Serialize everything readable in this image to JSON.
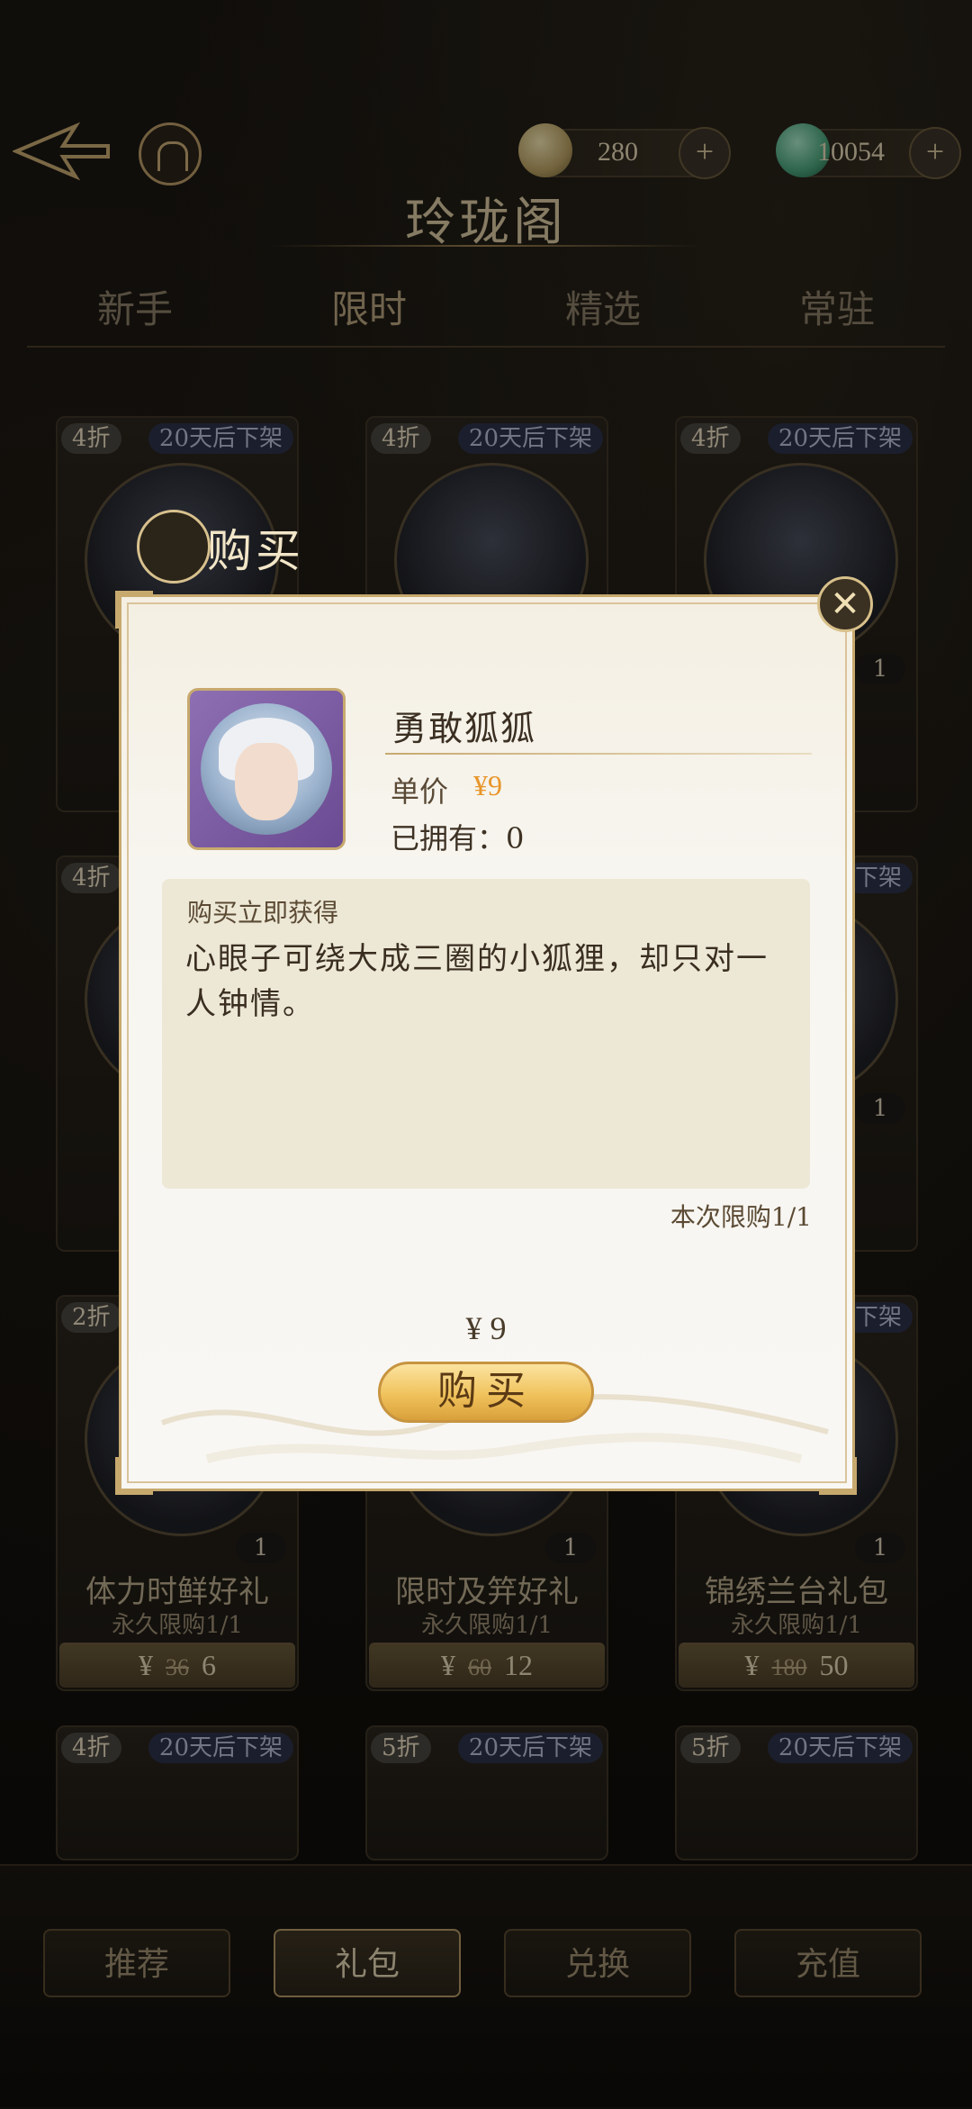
{
  "header": {
    "title": "玲珑阁",
    "currencies": [
      {
        "icon": "coin-icon",
        "value": "280"
      },
      {
        "icon": "jade-icon",
        "value": "10054"
      }
    ]
  },
  "tabs": [
    {
      "label": "新手",
      "active": false
    },
    {
      "label": "限时",
      "active": true
    },
    {
      "label": "精选",
      "active": false
    },
    {
      "label": "常驻",
      "active": false
    }
  ],
  "cards": [
    {
      "badge": "4折",
      "off": "20天后下架",
      "count": "",
      "name": "",
      "limit": "",
      "orig": "",
      "price": ""
    },
    {
      "badge": "4折",
      "off": "20天后下架",
      "count": "",
      "name": "",
      "limit": "",
      "orig": "",
      "price": ""
    },
    {
      "badge": "4折",
      "off": "20天后下架",
      "count": "1",
      "name": "",
      "limit": "",
      "orig": "",
      "price": ""
    },
    {
      "badge": "4折",
      "off": "",
      "count": "",
      "name": "",
      "limit": "",
      "orig": "",
      "price": ""
    },
    {
      "badge": "",
      "off": "",
      "count": "",
      "name": "",
      "limit": "",
      "orig": "",
      "price": ""
    },
    {
      "badge": "",
      "off": "下架",
      "count": "1",
      "name": "",
      "limit": "",
      "orig": "",
      "price": ""
    },
    {
      "badge": "2折",
      "off": "",
      "count": "1",
      "name": "体力时鲜好礼",
      "limit": "永久限购1/1",
      "orig": "36",
      "price": "6"
    },
    {
      "badge": "",
      "off": "",
      "count": "1",
      "name": "限时及笄好礼",
      "limit": "永久限购1/1",
      "orig": "60",
      "price": "12"
    },
    {
      "badge": "",
      "off": "下架",
      "count": "1",
      "name": "锦绣兰台礼包",
      "limit": "永久限购1/1",
      "orig": "180",
      "price": "50"
    },
    {
      "badge": "4折",
      "off": "20天后下架",
      "count": "",
      "name": "",
      "limit": "",
      "orig": "",
      "price": ""
    },
    {
      "badge": "5折",
      "off": "20天后下架",
      "count": "",
      "name": "",
      "limit": "",
      "orig": "",
      "price": ""
    },
    {
      "badge": "5折",
      "off": "20天后下架",
      "count": "",
      "name": "",
      "limit": "",
      "orig": "",
      "price": ""
    }
  ],
  "currency_symbol": "¥",
  "bottom_nav": [
    {
      "label": "推荐",
      "active": false
    },
    {
      "label": "礼包",
      "active": true
    },
    {
      "label": "兑换",
      "active": false
    },
    {
      "label": "充值",
      "active": false
    }
  ],
  "modal": {
    "title": "购买",
    "item_name": "勇敢狐狐",
    "unit_label": "单价",
    "unit_price": "¥9",
    "owned": "已拥有：0",
    "desc_title": "购买立即获得",
    "desc_text": "心眼子可绕大成三圈的小狐狸，却只对一人钟情。",
    "limit_note": "本次限购1/1",
    "total": "¥ 9",
    "buy_label": "购买",
    "close_icon": "close-icon"
  },
  "colors": {
    "accent": "#e8962a",
    "gold": "#c7a96e"
  }
}
